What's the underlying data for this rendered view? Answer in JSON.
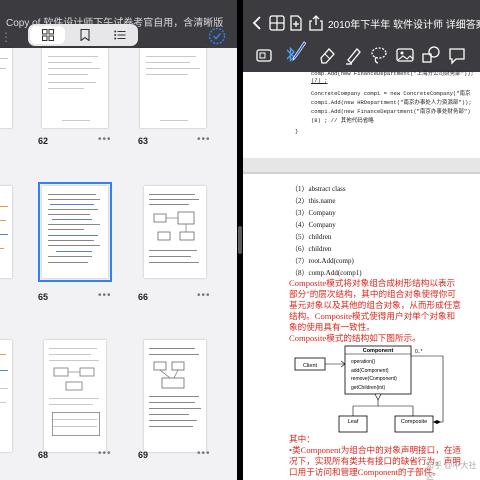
{
  "left": {
    "title": "Copy of 软件设计师下午试卷考官自用，含清晰版",
    "tabs": [
      {
        "icon": "grid-icon",
        "selected": true
      },
      {
        "icon": "bookmark-icon",
        "selected": false
      },
      {
        "icon": "list-icon",
        "selected": false
      }
    ],
    "pages": [
      {
        "num": "62",
        "more": "•••"
      },
      {
        "num": "63",
        "more": "•••"
      },
      {
        "num": "65",
        "more": "•••"
      },
      {
        "num": "66",
        "more": "•••"
      },
      {
        "num": "68",
        "more": "•••"
      },
      {
        "num": "69",
        "more": "•••"
      }
    ],
    "selected_page": "65"
  },
  "right": {
    "title": "2010年下半年 软件设计师 详细答案",
    "code_lines": [
      "comp.Add(new FinanceDepartment(\"上海分公司财务部\"));",
      "    (7)    ;",
      "ConcreteCompany comp1 = new ConcreteCompany(\"南京",
      "comp1.Add(new HRDepartment(\"南京办事处人力资源部\"));",
      "comp1.Add(new FinanceDepartment(\"南京办事处财务部\")",
      "    (8)    ;      // 其他代码省略",
      "}"
    ],
    "answers": [
      "（1）abstract class",
      "（2）this.name",
      "（3）Company",
      "（4）Company",
      "（5）children",
      "（6）children",
      "（7）root.Add(comp)",
      "（8）comp.Add(comp1)"
    ],
    "paragraph": [
      "Composite模式将对象组合成树形结构以表示",
      "部分\"的层次结构，其中的组合对象使得你可",
      "基元对象以及其他的组合对象，从而形成任意",
      "结构。Composite模式使得用户对单个对象和",
      "象的使用具有一致性。",
      "Composite模式的结构如下图所示。"
    ],
    "uml": {
      "client": "Client",
      "component": "Component",
      "methods": [
        "operation()",
        "add(Component)",
        "remove(Component)",
        "getChildren(int)"
      ],
      "leaf": "Leaf",
      "composite": "Composite",
      "multiplicity": "0..*"
    },
    "paragraph2": [
      "其中：",
      "•类Component为组合中的对象声明接口，在适",
      "况下，实现所有类共有接口的缺省行为，声明",
      "口用于访问和管理Component的子部件。"
    ],
    "watermark": "知乎 @中大社区"
  }
}
